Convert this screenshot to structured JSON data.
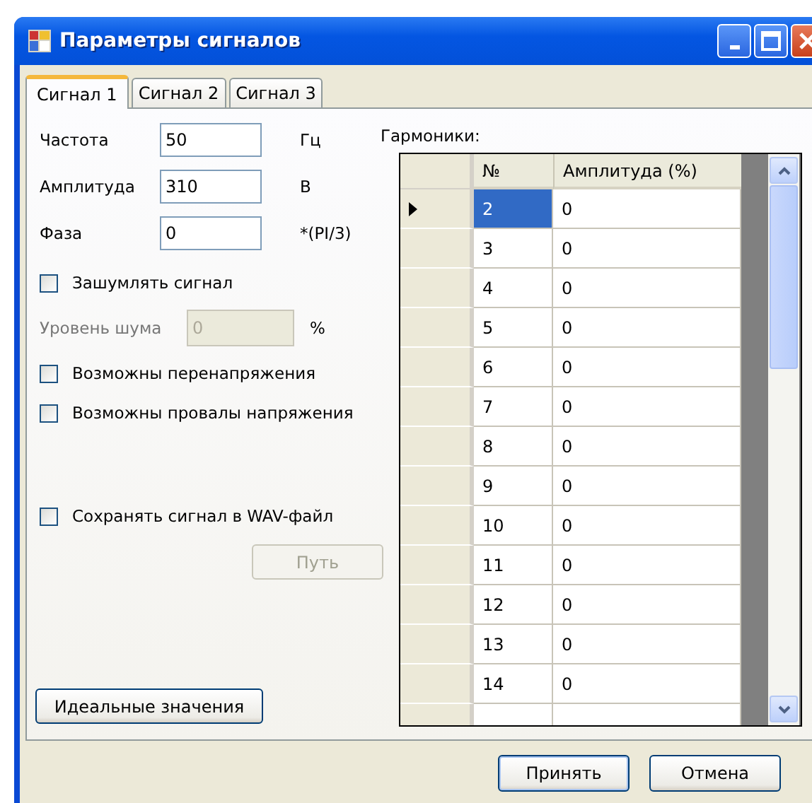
{
  "window": {
    "title": "Параметры сигналов"
  },
  "tabs": [
    {
      "label": "Сигнал 1",
      "selected": true
    },
    {
      "label": "Сигнал 2",
      "selected": false
    },
    {
      "label": "Сигнал 3",
      "selected": false
    }
  ],
  "fields": [
    {
      "label": "Частота",
      "value": "50",
      "unit": "Гц"
    },
    {
      "label": "Амплитуда",
      "value": "310",
      "unit": "В"
    },
    {
      "label": "Фаза",
      "value": "0",
      "unit": "*(PI/3)"
    }
  ],
  "noise_checkbox": {
    "label": "Зашумлять сигнал",
    "checked": false
  },
  "noise_level": {
    "label": "Уровень шума",
    "value": "0",
    "unit": "%",
    "disabled": true
  },
  "checkboxes": [
    {
      "label": "Возможны перенапряжения",
      "checked": false
    },
    {
      "label": "Возможны провалы напряжения",
      "checked": false
    }
  ],
  "wav_checkbox": {
    "label": "Сохранять сигнал в WAV-файл",
    "checked": false
  },
  "path_button": {
    "label": "Путь",
    "disabled": true
  },
  "ideal_button": {
    "label": "Идеальные значения"
  },
  "harmonics": {
    "label": "Гармоники:",
    "columns": [
      "№",
      "Амплитуда (%)"
    ],
    "rows": [
      {
        "number": "2",
        "amplitude": "0",
        "selected": true
      },
      {
        "number": "3",
        "amplitude": "0",
        "selected": false
      },
      {
        "number": "4",
        "amplitude": "0",
        "selected": false
      },
      {
        "number": "5",
        "amplitude": "0",
        "selected": false
      },
      {
        "number": "6",
        "amplitude": "0",
        "selected": false
      },
      {
        "number": "7",
        "amplitude": "0",
        "selected": false
      },
      {
        "number": "8",
        "amplitude": "0",
        "selected": false
      },
      {
        "number": "9",
        "amplitude": "0",
        "selected": false
      },
      {
        "number": "10",
        "amplitude": "0",
        "selected": false
      },
      {
        "number": "11",
        "amplitude": "0",
        "selected": false
      },
      {
        "number": "12",
        "amplitude": "0",
        "selected": false
      },
      {
        "number": "13",
        "amplitude": "0",
        "selected": false
      },
      {
        "number": "14",
        "amplitude": "0",
        "selected": false
      }
    ]
  },
  "buttons": [
    "Принять",
    "Отмена"
  ]
}
